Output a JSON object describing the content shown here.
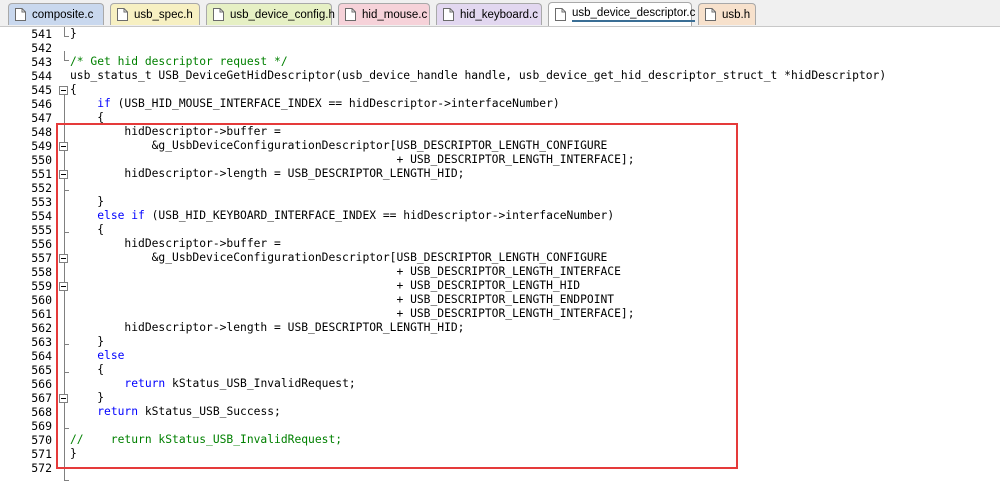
{
  "tabs": [
    {
      "label": "composite.c",
      "color": "#c9d8ee",
      "icon": "file-icon"
    },
    {
      "label": "usb_spec.h",
      "color": "#f7f0c2",
      "icon": "file-icon"
    },
    {
      "label": "usb_device_config.h",
      "color": "#e6f0c4",
      "icon": "file-icon"
    },
    {
      "label": "hid_mouse.c",
      "color": "#f6d2d9",
      "icon": "file-icon"
    },
    {
      "label": "hid_keyboard.c",
      "color": "#e2d7f0",
      "icon": "file-icon"
    },
    {
      "label": "usb_device_descriptor.c",
      "color": "#d5eee6",
      "icon": "file-icon",
      "active": true
    },
    {
      "label": "usb.h",
      "color": "#f7e1cc",
      "icon": "file-icon"
    }
  ],
  "editor": {
    "line_numbers": [
      "541",
      "542",
      "543",
      "544",
      "545",
      "546",
      "547",
      "548",
      "549",
      "550",
      "551",
      "552",
      "553",
      "554",
      "555",
      "556",
      "557",
      "558",
      "559",
      "560",
      "561",
      "562",
      "563",
      "564",
      "565",
      "566",
      "567",
      "568",
      "569",
      "570",
      "571",
      "572"
    ],
    "code": [
      [
        {
          "t": "}"
        }
      ],
      [],
      [
        {
          "t": "/* Get hid descriptor request */",
          "c": "cm"
        }
      ],
      [
        {
          "t": "usb_status_t USB_DeviceGetHidDescriptor(usb_device_handle handle, usb_device_get_hid_descriptor_struct_t *hidDescriptor)"
        }
      ],
      [
        {
          "t": "{"
        }
      ],
      [
        {
          "t": "    "
        },
        {
          "t": "if",
          "c": "kw"
        },
        {
          "t": " (USB_HID_MOUSE_INTERFACE_INDEX == hidDescriptor->interfaceNumber)"
        }
      ],
      [
        {
          "t": "    {"
        }
      ],
      [
        {
          "t": "        hidDescriptor->buffer ="
        }
      ],
      [
        {
          "t": "            &g_UsbDeviceConfigurationDescriptor[USB_DESCRIPTOR_LENGTH_CONFIGURE"
        }
      ],
      [
        {
          "t": "                                                + USB_DESCRIPTOR_LENGTH_INTERFACE];"
        }
      ],
      [
        {
          "t": "        hidDescriptor->length = USB_DESCRIPTOR_LENGTH_HID;"
        }
      ],
      [],
      [
        {
          "t": "    }"
        }
      ],
      [
        {
          "t": "    "
        },
        {
          "t": "else if",
          "c": "kw"
        },
        {
          "t": " (USB_HID_KEYBOARD_INTERFACE_INDEX == hidDescriptor->interfaceNumber)"
        }
      ],
      [
        {
          "t": "    {"
        }
      ],
      [
        {
          "t": "        hidDescriptor->buffer ="
        }
      ],
      [
        {
          "t": "            &g_UsbDeviceConfigurationDescriptor[USB_DESCRIPTOR_LENGTH_CONFIGURE"
        }
      ],
      [
        {
          "t": "                                                + USB_DESCRIPTOR_LENGTH_INTERFACE"
        }
      ],
      [
        {
          "t": "                                                + USB_DESCRIPTOR_LENGTH_HID"
        }
      ],
      [
        {
          "t": "                                                + USB_DESCRIPTOR_LENGTH_ENDPOINT"
        }
      ],
      [
        {
          "t": "                                                + USB_DESCRIPTOR_LENGTH_INTERFACE];"
        }
      ],
      [
        {
          "t": "        hidDescriptor->length = USB_DESCRIPTOR_LENGTH_HID;"
        }
      ],
      [
        {
          "t": "    }"
        }
      ],
      [
        {
          "t": "    "
        },
        {
          "t": "else",
          "c": "kw"
        }
      ],
      [
        {
          "t": "    {"
        }
      ],
      [
        {
          "t": "        "
        },
        {
          "t": "return",
          "c": "kw"
        },
        {
          "t": " kStatus_USB_InvalidRequest;"
        }
      ],
      [
        {
          "t": "    }"
        }
      ],
      [
        {
          "t": "    "
        },
        {
          "t": "return",
          "c": "kw"
        },
        {
          "t": " kStatus_USB_Success;"
        }
      ],
      [],
      [
        {
          "t": "//    return kStatus_USB_InvalidRequest;",
          "c": "cm"
        }
      ],
      [
        {
          "t": "}"
        }
      ],
      []
    ]
  },
  "colors": {
    "highlight_box": "#e53a3a",
    "keyword": "#0000ff",
    "comment": "#008000"
  }
}
